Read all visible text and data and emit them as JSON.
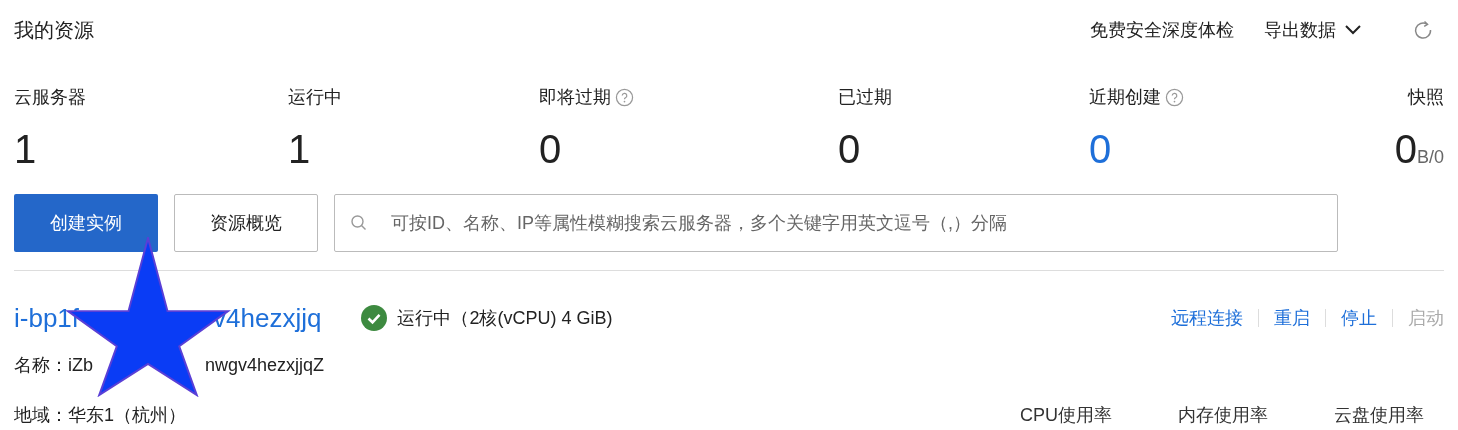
{
  "header": {
    "title": "我的资源",
    "links": [
      {
        "label": "免费安全深度体检",
        "dropdown": false
      },
      {
        "label": "导出数据",
        "dropdown": true
      }
    ]
  },
  "stats": [
    {
      "label": "云服务器",
      "value": "1",
      "help": false,
      "highlight": false
    },
    {
      "label": "运行中",
      "value": "1",
      "help": false,
      "highlight": false
    },
    {
      "label": "即将过期",
      "value": "0",
      "help": true,
      "highlight": false
    },
    {
      "label": "已过期",
      "value": "0",
      "help": false,
      "highlight": false
    },
    {
      "label": "近期创建",
      "value": "0",
      "help": true,
      "highlight": true
    },
    {
      "label": "快照",
      "value": "0",
      "unit": "B/0",
      "help": false,
      "highlight": false
    }
  ],
  "buttons": [
    {
      "label": "创建实例",
      "primary": true
    },
    {
      "label": "资源概览",
      "primary": false
    }
  ],
  "search": {
    "placeholder": "可按ID、名称、IP等属性模糊搜索云服务器，多个关键字用英文逗号（,）分隔"
  },
  "instance": {
    "id_parts": [
      "i-bp1f",
      "v4hezxjjq"
    ],
    "status": "运行中",
    "spec": "（2核(vCPU) 4 GiB)",
    "actions": [
      {
        "label": "远程连接",
        "disabled": false
      },
      {
        "label": "重启",
        "disabled": false
      },
      {
        "label": "停止",
        "disabled": false
      },
      {
        "label": "启动",
        "disabled": true
      }
    ],
    "name_parts": [
      "名称：iZb",
      "nwgv4hezxjjqZ"
    ],
    "region": "地域：华东1（杭州）",
    "metrics": [
      "CPU使用率",
      "内存使用率",
      "云盘使用率"
    ]
  }
}
